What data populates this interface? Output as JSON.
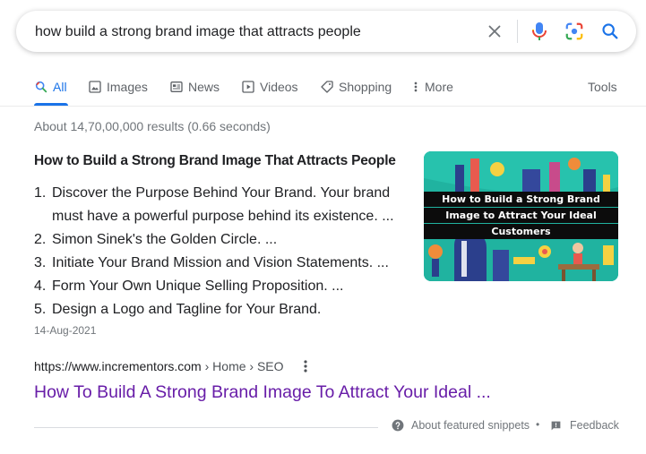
{
  "search": {
    "query": "how build a strong brand image that attracts people",
    "icons": [
      "close-icon",
      "microphone-icon",
      "google-lens-icon",
      "search-icon"
    ]
  },
  "tabs": [
    {
      "label": "All",
      "icon": "search-icon",
      "active": true
    },
    {
      "label": "Images",
      "icon": "image-icon"
    },
    {
      "label": "News",
      "icon": "news-icon"
    },
    {
      "label": "Videos",
      "icon": "play-icon"
    },
    {
      "label": "Shopping",
      "icon": "tag-icon"
    },
    {
      "label": "More",
      "icon": "more-vertical-icon"
    }
  ],
  "tools_label": "Tools",
  "result_stats": "About 14,70,00,000 results (0.66 seconds)",
  "featured_snippet": {
    "title": "How to Build a Strong Brand Image That Attracts People",
    "steps": [
      {
        "num": "1.",
        "text": "Discover the Purpose Behind Your Brand. Your brand must have a powerful purpose behind its existence. ..."
      },
      {
        "num": "2.",
        "text": "Simon Sinek's the Golden Circle. ..."
      },
      {
        "num": "3.",
        "text": "Initiate Your Brand Mission and Vision Statements. ..."
      },
      {
        "num": "4.",
        "text": "Form Your Own Unique Selling Proposition. ..."
      },
      {
        "num": "5.",
        "text": "Design a Logo and Tagline for Your Brand."
      }
    ],
    "date": "14-Aug-2021",
    "image": {
      "caption_lines": [
        "How to Build a Strong Brand",
        "Image to Attract Your Ideal",
        "Customers"
      ]
    }
  },
  "result": {
    "url": "https://www.incrementors.com",
    "breadcrumb": " › Home › SEO",
    "title": "How To Build A Strong Brand Image To Attract Your Ideal ..."
  },
  "footer": {
    "about_label": "About featured snippets",
    "separator": "•",
    "feedback_label": "Feedback"
  },
  "colors": {
    "accent": "#1a73e8",
    "visited_link": "#681da8",
    "muted_text": "#70757a",
    "image_background": "#20b3a0"
  }
}
